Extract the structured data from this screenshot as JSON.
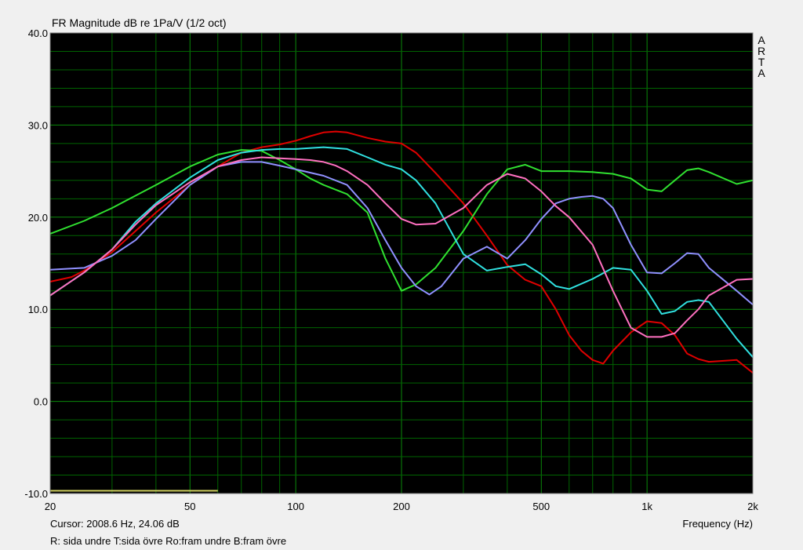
{
  "chart_data": {
    "type": "line",
    "title": "FR Magnitude dB re 1Pa/V (1/2 oct)",
    "brand": "ARTA",
    "xlabel": "Frequency (Hz)",
    "xscale": "log",
    "xlim": [
      20,
      2000
    ],
    "ylim": [
      -10,
      40
    ],
    "grid": true,
    "background": "#000000",
    "grid_color": "#006400",
    "x_ticks": [
      {
        "value": 20,
        "label": "20"
      },
      {
        "value": 50,
        "label": "50"
      },
      {
        "value": 100,
        "label": "100"
      },
      {
        "value": 200,
        "label": "200"
      },
      {
        "value": 500,
        "label": "500"
      },
      {
        "value": 1000,
        "label": "1k"
      },
      {
        "value": 2000,
        "label": "2k"
      }
    ],
    "y_ticks": [
      {
        "value": 40,
        "label": "40.0"
      },
      {
        "value": 30,
        "label": "30.0"
      },
      {
        "value": 20,
        "label": "20.0"
      },
      {
        "value": 10,
        "label": "10.0"
      },
      {
        "value": 0,
        "label": "0.0"
      },
      {
        "value": -10,
        "label": "-10.0"
      }
    ],
    "series": [
      {
        "color": "#e00000",
        "x": [
          20,
          23,
          25,
          30,
          35,
          40,
          50,
          60,
          70,
          80,
          90,
          100,
          110,
          120,
          130,
          140,
          160,
          180,
          200,
          220,
          250,
          300,
          350,
          400,
          450,
          500,
          550,
          600,
          650,
          700,
          750,
          800,
          900,
          1000,
          1100,
          1200,
          1300,
          1400,
          1500,
          1800,
          2000
        ],
        "y": [
          13,
          13.5,
          14.2,
          16.2,
          18.5,
          20.5,
          23.5,
          25.5,
          27,
          27.6,
          27.9,
          28.3,
          28.8,
          29.2,
          29.3,
          29.2,
          28.6,
          28.2,
          28,
          27,
          24.8,
          21.5,
          18,
          14.8,
          13.2,
          12.5,
          10,
          7.2,
          5.5,
          4.5,
          4.1,
          5.5,
          7.5,
          8.7,
          8.5,
          7.2,
          5.2,
          4.6,
          4.3,
          4.5,
          3.1
        ]
      },
      {
        "color": "#30e030",
        "x": [
          20,
          25,
          30,
          40,
          50,
          60,
          70,
          80,
          90,
          100,
          110,
          120,
          140,
          160,
          180,
          200,
          220,
          250,
          300,
          350,
          400,
          450,
          500,
          600,
          700,
          800,
          900,
          1000,
          1100,
          1200,
          1300,
          1400,
          1500,
          1800,
          2000
        ],
        "y": [
          18.2,
          19.6,
          21,
          23.5,
          25.5,
          26.8,
          27.3,
          27.2,
          26.2,
          25.2,
          24.2,
          23.5,
          22.5,
          20.5,
          15.5,
          12,
          12.7,
          14.5,
          18.5,
          22.5,
          25.2,
          25.7,
          25,
          25,
          24.9,
          24.7,
          24.2,
          23,
          22.8,
          24,
          25.1,
          25.3,
          24.9,
          23.6,
          24
        ]
      },
      {
        "color": "#30e0e0",
        "x": [
          20,
          25,
          30,
          35,
          40,
          50,
          60,
          70,
          80,
          90,
          100,
          120,
          140,
          160,
          180,
          200,
          220,
          250,
          300,
          350,
          400,
          450,
          500,
          550,
          600,
          700,
          800,
          900,
          1000,
          1100,
          1200,
          1300,
          1400,
          1500,
          1800,
          2000
        ],
        "y": [
          11.5,
          14,
          16.5,
          19.5,
          21.5,
          24.3,
          26.2,
          27,
          27.3,
          27.4,
          27.4,
          27.6,
          27.4,
          26.5,
          25.7,
          25.2,
          24,
          21.5,
          16,
          14.2,
          14.6,
          14.9,
          13.8,
          12.5,
          12.2,
          13.3,
          14.5,
          14.3,
          12,
          9.5,
          9.8,
          10.8,
          11,
          10.8,
          6.8,
          4.8
        ]
      },
      {
        "color": "#9090ff",
        "x": [
          20,
          25,
          30,
          35,
          40,
          50,
          60,
          70,
          80,
          90,
          100,
          120,
          140,
          160,
          180,
          200,
          220,
          240,
          260,
          300,
          350,
          400,
          450,
          500,
          550,
          600,
          650,
          700,
          750,
          800,
          900,
          1000,
          1100,
          1200,
          1300,
          1400,
          1500,
          1800,
          2000
        ],
        "y": [
          14.3,
          14.5,
          15.8,
          17.5,
          19.8,
          23.5,
          25.5,
          26,
          26,
          25.6,
          25.2,
          24.5,
          23.5,
          21,
          17.5,
          14.5,
          12.5,
          11.6,
          12.5,
          15.5,
          16.8,
          15.5,
          17.5,
          19.8,
          21.5,
          22,
          22.2,
          22.3,
          22,
          21,
          17,
          14,
          13.9,
          15,
          16.1,
          16,
          14.5,
          12,
          10.5
        ]
      },
      {
        "color": "#ff70c0",
        "x": [
          20,
          25,
          30,
          35,
          40,
          50,
          60,
          70,
          80,
          90,
          100,
          110,
          120,
          130,
          140,
          160,
          180,
          200,
          220,
          250,
          300,
          350,
          400,
          450,
          500,
          550,
          600,
          700,
          800,
          900,
          1000,
          1100,
          1200,
          1300,
          1400,
          1500,
          1800,
          2000
        ],
        "y": [
          11.5,
          14,
          16.5,
          19.2,
          21.3,
          23.8,
          25.5,
          26.2,
          26.5,
          26.4,
          26.3,
          26.2,
          26,
          25.6,
          25,
          23.5,
          21.5,
          19.8,
          19.2,
          19.3,
          21,
          23.5,
          24.7,
          24.2,
          22.8,
          21.2,
          20,
          17,
          12,
          8,
          7,
          7,
          7.4,
          8.8,
          10,
          11.5,
          13.2,
          13.3
        ]
      }
    ],
    "annotation_line_color": "#d0d060",
    "annotation_line_x": [
      20,
      60
    ],
    "annotation_line_y": -9.7
  },
  "cursor_text": "Cursor: 2008.6 Hz, 24.06 dB",
  "legend_text": "R: sida undre T:sida övre Ro:fram undre B:fram övre"
}
